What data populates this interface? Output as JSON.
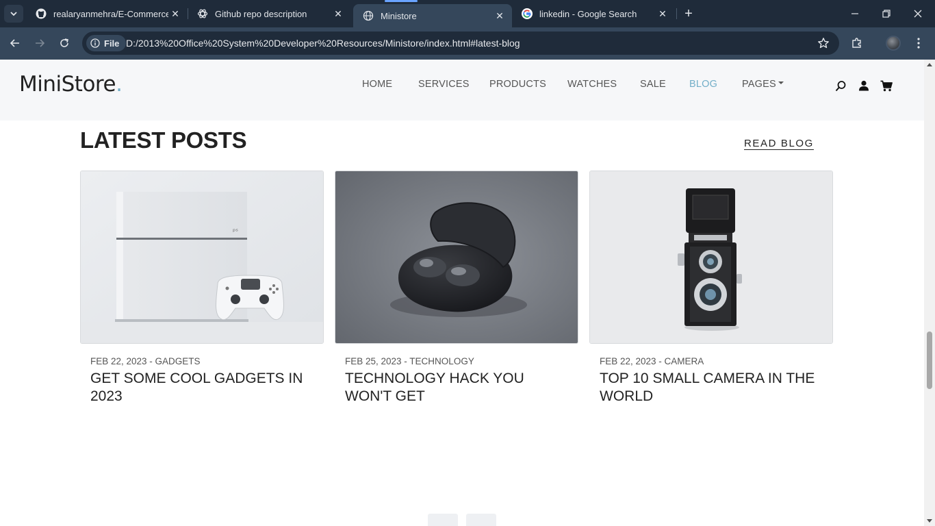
{
  "browser": {
    "tabs": [
      {
        "title": "realaryanmehra/E-Commerce-W",
        "icon": "github-icon"
      },
      {
        "title": "Github repo description",
        "icon": "chatgpt-icon"
      },
      {
        "title": "Ministore",
        "icon": "globe-icon",
        "active": true
      },
      {
        "title": "linkedin - Google Search",
        "icon": "google-icon"
      }
    ],
    "url_chip": "File",
    "url": "D:/2013%20Office%20System%20Developer%20Resources/Ministore/index.html#latest-blog"
  },
  "site": {
    "logo": "MiniStore",
    "logo_dot": ".",
    "nav": [
      "HOME",
      "SERVICES",
      "PRODUCTS",
      "WATCHES",
      "SALE",
      "BLOG",
      "PAGES"
    ],
    "active_nav": "BLOG",
    "accent_color": "#72aec8"
  },
  "section": {
    "title": "LATEST POSTS",
    "read_blog": "READ BLOG"
  },
  "posts": [
    {
      "meta": "FEB 22, 2023 - GADGETS",
      "title": "GET SOME COOL GADGETS IN 2023",
      "image": "game-console-image"
    },
    {
      "meta": "FEB 25, 2023 - TECHNOLOGY",
      "title": "TECHNOLOGY HACK YOU WON'T GET",
      "image": "earbuds-image"
    },
    {
      "meta": "FEB 22, 2023 - CAMERA",
      "title": "TOP 10 SMALL CAMERA IN THE WORLD",
      "image": "camera-image"
    }
  ]
}
